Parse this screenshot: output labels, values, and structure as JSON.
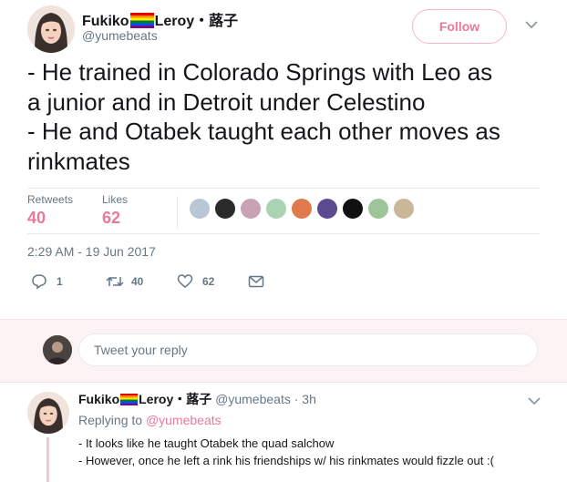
{
  "tweet": {
    "display_name_part1": "Fukiko",
    "display_name_part2": "Leroy・蕗子",
    "handle": "@yumebeats",
    "follow_label": "Follow",
    "text_lines": [
      "- He trained in Colorado Springs with Leo as",
      "a junior and in Detroit under Celestino",
      "- He and Otabek taught each other moves as",
      "rinkmates"
    ],
    "retweets_label": "Retweets",
    "retweets_count": "40",
    "likes_label": "Likes",
    "likes_count": "62",
    "timestamp": "2:29 AM - 19 Jun 2017",
    "actions": {
      "reply_count": "1",
      "retweet_count": "40",
      "like_count": "62"
    }
  },
  "reply_composer": {
    "placeholder": "Tweet your reply"
  },
  "reply": {
    "display_name_part1": "Fukiko",
    "display_name_part2": "Leroy・蕗子",
    "handle": "@yumebeats",
    "time": "· 3h",
    "replying_prefix": "Replying to",
    "replying_to": "@yumebeats",
    "lines": [
      "- It looks like he taught Otabek the quad salchow",
      "- However, once he left a rink his friendships w/ his rinkmates would fizzle out :("
    ]
  },
  "colors": {
    "accent_pink": "#e8799a",
    "text": "#14171a",
    "muted": "#657786"
  }
}
